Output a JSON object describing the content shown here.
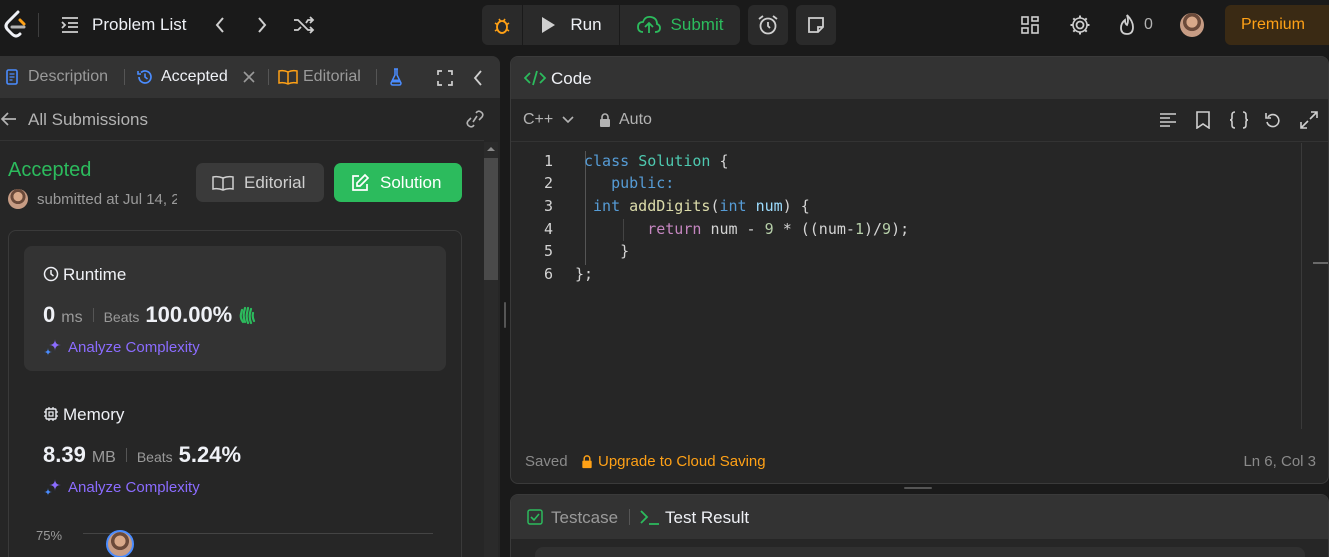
{
  "nav": {
    "title": "Problem List",
    "run_label": "Run",
    "submit_label": "Submit",
    "streak": "0",
    "premium_label": "Premium"
  },
  "left": {
    "tabs": [
      {
        "label": "Description"
      },
      {
        "label": "Accepted"
      },
      {
        "label": "Editorial"
      }
    ],
    "back_label": "All Submissions",
    "status": "Accepted",
    "submitted": "submitted at Jul 14, 2",
    "editorial_btn": "Editorial",
    "solution_btn": "Solution",
    "runtime": {
      "title": "Runtime",
      "value": "0",
      "unit": "ms",
      "beats_label": "Beats",
      "beats_value": "100.00%",
      "analyze": "Analyze Complexity"
    },
    "memory": {
      "title": "Memory",
      "value": "8.39",
      "unit": "MB",
      "beats_label": "Beats",
      "beats_value": "5.24%",
      "analyze": "Analyze Complexity"
    },
    "chart_tick": "75%"
  },
  "editor": {
    "title": "Code",
    "language": "C++",
    "auto_label": "Auto",
    "line_numbers": [
      "1",
      "2",
      "3",
      "4",
      "5",
      "6"
    ],
    "saved": "Saved",
    "upgrade": "Upgrade to Cloud Saving",
    "cursor": "Ln 6, Col 3"
  },
  "bottom": {
    "testcase": "Testcase",
    "test_result": "Test Result"
  },
  "colors": {
    "accent_green": "#2cbb5d",
    "premium_orange": "#ffa116",
    "analyze_purple": "#8b6cff"
  }
}
